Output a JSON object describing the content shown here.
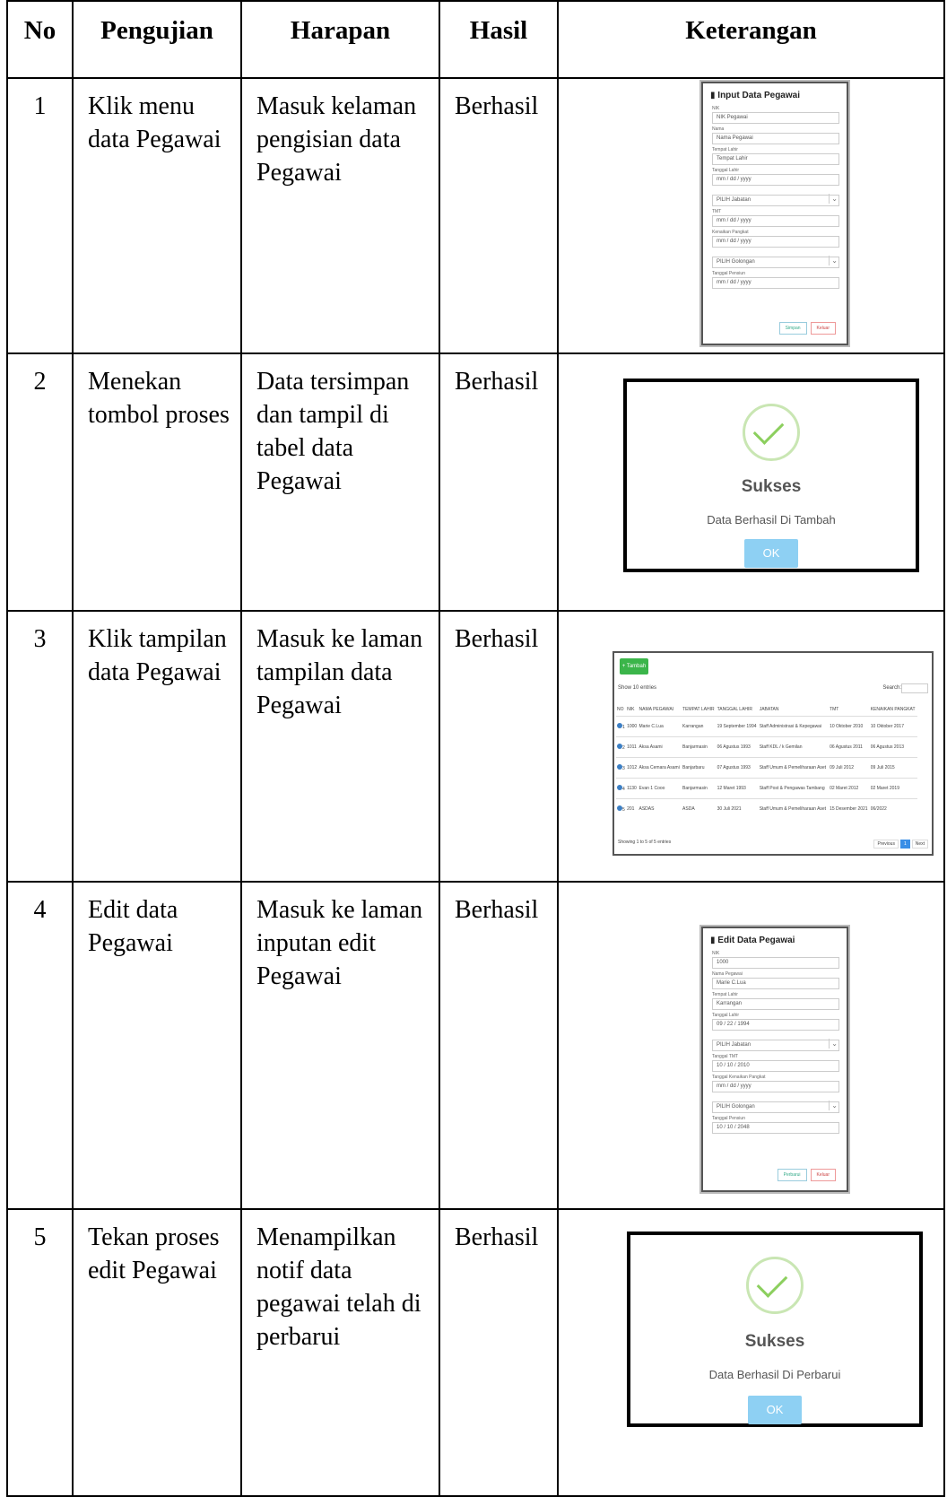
{
  "headers": {
    "no": "No",
    "pengujian": "Pengujian",
    "harapan": "Harapan",
    "hasil": "Hasil",
    "keterangan": "Keterangan"
  },
  "rows": [
    {
      "no": "1",
      "pengujian": "Klik menu data Pegawai",
      "harapan": "Masuk kelaman pengisian data Pegawai",
      "hasil": "Berhasil"
    },
    {
      "no": "2",
      "pengujian": "Menekan tombol proses",
      "harapan": "Data tersimpan dan tampil di tabel data Pegawai",
      "hasil": "Berhasil"
    },
    {
      "no": "3",
      "pengujian": "Klik tampilan data Pegawai",
      "harapan": "Masuk ke laman tampilan data Pegawai",
      "hasil": "Berhasil"
    },
    {
      "no": "4",
      "pengujian": "Edit data Pegawai",
      "harapan": "Masuk ke laman inputan edit Pegawai",
      "hasil": "Berhasil"
    },
    {
      "no": "5",
      "pengujian": "Tekan proses edit Pegawai",
      "harapan": "Menampilkan notif data pegawai telah di perbarui",
      "hasil": "Berhasil"
    }
  ],
  "input_form": {
    "title": "Input Data Pegawai",
    "fields": [
      {
        "label": "NIK",
        "value": "NIK Pegawai"
      },
      {
        "label": "Nama",
        "value": "Nama Pegawai"
      },
      {
        "label": "Tempat Lahir",
        "value": "Tempat Lahir"
      },
      {
        "label": "Tanggal Lahir",
        "value": "mm / dd / yyyy"
      },
      {
        "label": "",
        "value": "PILIH Jabatan",
        "select": true
      },
      {
        "label": "TMT",
        "value": "mm / dd / yyyy"
      },
      {
        "label": "Kenaikan Pangkat",
        "value": "mm / dd / yyyy"
      },
      {
        "label": "",
        "value": "PILIH Golongan",
        "select": true
      },
      {
        "label": "Tanggal Pensiun",
        "value": "mm / dd / yyyy"
      }
    ],
    "buttons": {
      "save": "Simpan",
      "cancel": "Keluar"
    }
  },
  "dialog_add": {
    "title": "Sukses",
    "message": "Data Berhasil Di Tambah",
    "ok": "OK"
  },
  "list_view": {
    "add_button": "+ Tambah",
    "show_text": "Show 10 entries",
    "search_label": "Search:",
    "columns": [
      "NO",
      "NIK",
      "NAMA PEGAWAI",
      "TEMPAT LAHIR",
      "TANGGAL LAHIR",
      "JABATAN",
      "TMT",
      "KENAIKAN PANGKAT"
    ],
    "rows": [
      [
        "1",
        "1000",
        "Marie C.Lua",
        "Karrangan",
        "19 September 1994",
        "Staff Administrasi & Kepegawai",
        "10 Oktober 2010",
        "10 Oktober 2017"
      ],
      [
        "2",
        "1011",
        "Aksa Asami",
        "Banjarmasin",
        "06 Agustus 1993",
        "Staff KDL / k Gemilan",
        "06 Agustus 2011",
        "06 Agustus 2013"
      ],
      [
        "3",
        "1012",
        "Aksa Cemara Asami",
        "Banjarbaru",
        "07 Agustus 1993",
        "Staff Umum & Pemeliharaan Aset",
        "09 Juli 2012",
        "09 Juli 2015"
      ],
      [
        "4",
        "1130",
        "Evan 1 Cooo",
        "Banjarmasin",
        "12 Maret 1993",
        "Staff Post & Pengawas Tambang",
        "02 Maret 2012",
        "02 Maret 2019"
      ],
      [
        "5",
        "201",
        "ASDAS",
        "ASDA",
        "30 Juli 2021",
        "Staff Umum & Pemeliharaan Aset",
        "15 Desember 2021",
        "06/2022"
      ]
    ],
    "footer": "Showing 1 to 5 of 5 entries",
    "pager": {
      "prev": "Previous",
      "page": "1",
      "next": "Next"
    }
  },
  "edit_form": {
    "title": "Edit Data Pegawai",
    "fields": [
      {
        "label": "NIK",
        "value": "1000"
      },
      {
        "label": "Nama Pegawai",
        "value": "Marie C.Lua"
      },
      {
        "label": "Tempat Lahir",
        "value": "Karrangan"
      },
      {
        "label": "Tanggal Lahir",
        "value": "09 / 22 / 1994"
      },
      {
        "label": "",
        "value": "PILIH Jabatan",
        "select": true
      },
      {
        "label": "Tanggal TMT",
        "value": "10 / 10 / 2010"
      },
      {
        "label": "Tanggal Kenaikan Pangkat",
        "value": "mm / dd / yyyy"
      },
      {
        "label": "",
        "value": "PILIH Golongan",
        "select": true
      },
      {
        "label": "Tanggal Pensiun",
        "value": "10 / 10 / 2048"
      }
    ],
    "buttons": {
      "save": "Perbarui",
      "cancel": "Keluar"
    }
  },
  "dialog_edit": {
    "title": "Sukses",
    "message": "Data Berhasil Di Perbarui",
    "ok": "OK"
  }
}
